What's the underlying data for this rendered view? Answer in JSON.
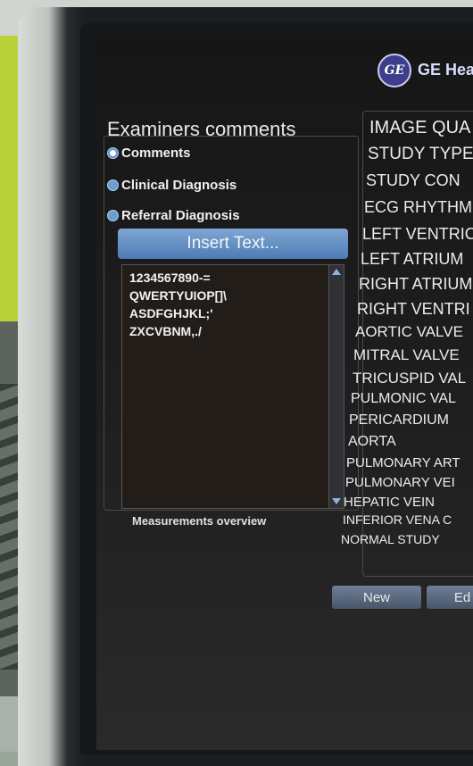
{
  "header": {
    "logo_text": "GE",
    "brand": "GE Hea"
  },
  "examiners": {
    "title": "Examiners comments",
    "options": [
      {
        "label": "Comments",
        "selected": true
      },
      {
        "label": "Clinical Diagnosis",
        "selected": false
      },
      {
        "label": "Referral Diagnosis",
        "selected": false
      }
    ],
    "insert_label": "Insert Text...",
    "text_lines": [
      "1234567890-=",
      "QWERTYUIOP[]\\",
      "ASDFGHJKL;'",
      "ZXCVBNM,./"
    ]
  },
  "measurements": {
    "label": "Measurements overview"
  },
  "categories": [
    "IMAGE QUA",
    "STUDY TYPE",
    "STUDY CON",
    "ECG RHYTHM",
    "LEFT VENTRIC",
    "LEFT ATRIUM",
    "RIGHT ATRIUM",
    "RIGHT VENTRI",
    "AORTIC VALVE",
    "MITRAL VALVE",
    "TRICUSPID VAL",
    "PULMONIC VAL",
    "PERICARDIUM",
    "AORTA",
    "PULMONARY ART",
    "PULMONARY VEI",
    "HEPATIC VEIN",
    "INFERIOR VENA C",
    "NORMAL STUDY"
  ],
  "buttons": {
    "new": "New",
    "edit": "Ed"
  },
  "colors": {
    "accent": "#5b8fc7",
    "button_gray": "#5a687c",
    "screen_bg": "#1a1a1a"
  }
}
